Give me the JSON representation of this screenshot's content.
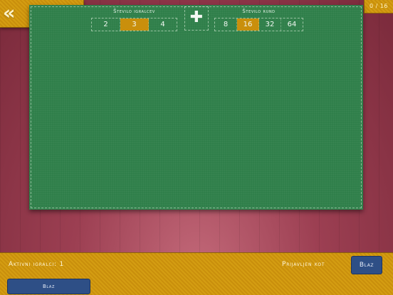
{
  "nav": {
    "first_glyph": "«",
    "next_glyph": "›",
    "last_glyph": "»"
  },
  "counter": {
    "text": "0 / 16"
  },
  "players": {
    "title": "Število igralcev",
    "options": [
      "2",
      "3",
      "4"
    ],
    "selected": "3"
  },
  "add": {
    "glyph": "✚"
  },
  "rounds": {
    "title": "Število rund",
    "options": [
      "8",
      "16",
      "32",
      "64"
    ],
    "selected": "16"
  },
  "footer": {
    "active_players": "Aktivni igralci: 1",
    "logged_in_as": "Prijavljen kot",
    "user_button": "Blaz",
    "player_chip": "Blaz"
  },
  "colors": {
    "board": "#2f7f4a",
    "accent": "#c98f0c",
    "user_button": "#2e4f86"
  }
}
